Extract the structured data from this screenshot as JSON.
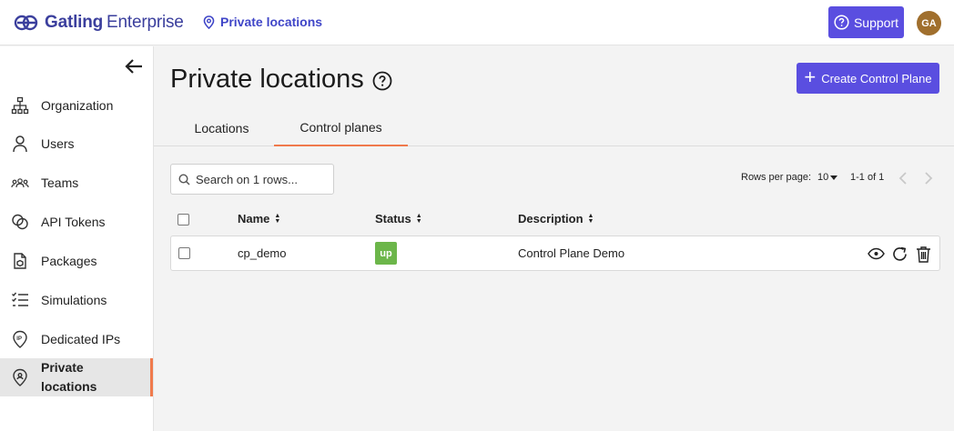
{
  "topbar": {
    "brand_bold": "Gatling",
    "brand_light": "Enterprise",
    "breadcrumb": "Private locations",
    "support_label": "Support",
    "avatar_initials": "GA",
    "accent_color": "#5a4ee0"
  },
  "sidebar": {
    "items": [
      {
        "label": "Organization",
        "icon": "sitemap-icon"
      },
      {
        "label": "Users",
        "icon": "user-icon"
      },
      {
        "label": "Teams",
        "icon": "teams-icon"
      },
      {
        "label": "API Tokens",
        "icon": "tokens-icon"
      },
      {
        "label": "Packages",
        "icon": "package-icon"
      },
      {
        "label": "Simulations",
        "icon": "checklist-icon"
      },
      {
        "label": "Dedicated IPs",
        "icon": "ip-pin-icon"
      },
      {
        "label": "Private\nlocations",
        "icon": "location-icon",
        "active": true
      }
    ]
  },
  "main": {
    "title": "Private locations",
    "create_button": "Create Control Plane",
    "tabs": [
      {
        "label": "Locations",
        "active": false
      },
      {
        "label": "Control planes",
        "active": true
      }
    ],
    "search_placeholder": "Search on 1 rows...",
    "pagination": {
      "rows_per_page_label": "Rows per page:",
      "rows_per_page_value": "10",
      "range": "1-1 of 1"
    },
    "table": {
      "columns": [
        "Name",
        "Status",
        "Description"
      ],
      "rows": [
        {
          "name": "cp_demo",
          "status": "up",
          "description": "Control Plane Demo"
        }
      ]
    }
  }
}
